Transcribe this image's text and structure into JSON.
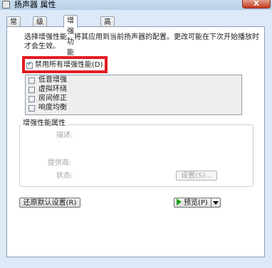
{
  "window": {
    "title": "扬声器 属性",
    "close_label": "X"
  },
  "tabs": [
    {
      "label": "常规"
    },
    {
      "label": "级别"
    },
    {
      "label": "增强功能"
    },
    {
      "label": "高级"
    }
  ],
  "description": "选择增强性能，将其应用到当前扬声器的配置。更改可能在下次开始播放时才会生效。",
  "disable_all": {
    "label": "禁用所有增强性能(D)",
    "checked": true
  },
  "enhancements": [
    {
      "label": "低音增强",
      "checked": false
    },
    {
      "label": "虚拟环绕",
      "checked": false
    },
    {
      "label": "房间修正",
      "checked": false
    },
    {
      "label": "响度均衡",
      "checked": false
    }
  ],
  "properties": {
    "title": "增强性能属性",
    "description_label": "描述:",
    "provider_label": "提供商:",
    "status_label": "状态:",
    "settings_button": "设置(S)..."
  },
  "footer": {
    "restore_button": "还原默认设置(R)",
    "preview_button": "预览(P)"
  },
  "colors": {
    "highlight": "#e31b23",
    "play": "#20a020"
  }
}
